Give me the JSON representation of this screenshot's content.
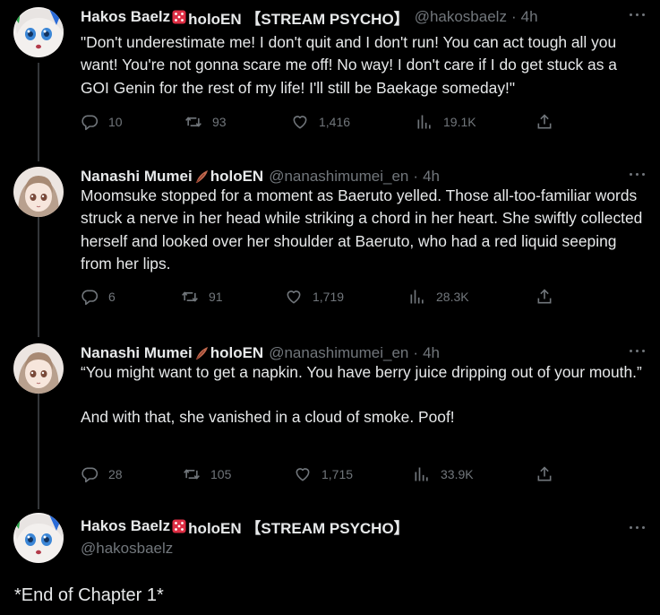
{
  "tweets": [
    {
      "name": "Hakos Baelz",
      "name_suffix": "holoEN 【STREAM PSYCHO】",
      "handle": "@hakosbaelz",
      "time": "4h",
      "text": [
        "\"Don't underestimate me! I don't quit and I don't run! You can act tough all you want! You're not gonna scare me off! No way! I don't care if I do get stuck as a GOI Genin for the rest of my life! I'll still be Baekage someday!\""
      ],
      "replies": "10",
      "retweets": "93",
      "likes": "1,416",
      "views": "19.1K"
    },
    {
      "name": "Nanashi Mumei",
      "name_suffix": "holoEN",
      "handle": "@nanashimumei_en",
      "time": "4h",
      "text": [
        "Moomsuke stopped for a moment as Baeruto yelled. Those all-too-familiar words struck a nerve in her head while striking a chord in her heart. She swiftly collected herself and looked over her shoulder at Baeruto, who had a red liquid seeping from her lips."
      ],
      "replies": "6",
      "retweets": "91",
      "likes": "1,719",
      "views": "28.3K"
    },
    {
      "name": "Nanashi Mumei",
      "name_suffix": "holoEN",
      "handle": "@nanashimumei_en",
      "time": "4h",
      "text": [
        "“You might want to get a napkin. You have berry juice dripping out of your mouth.”",
        "And with that, she vanished in a cloud of smoke. Poof!"
      ],
      "replies": "28",
      "retweets": "105",
      "likes": "1,715",
      "views": "33.9K"
    },
    {
      "name": "Hakos Baelz",
      "name_suffix": "holoEN 【STREAM PSYCHO】",
      "handle": "@hakosbaelz",
      "text": [
        "*End of Chapter 1*"
      ]
    }
  ],
  "icons": {
    "reply": "reply-icon",
    "retweet": "retweet-icon",
    "like": "heart-icon",
    "views": "views-icon",
    "share": "share-icon",
    "more": "more-icon",
    "die": "die-emoji",
    "quill": "quill-emoji"
  },
  "colors": {
    "background": "#000000",
    "text": "#e7e9ea",
    "muted": "#71767b",
    "line": "#333639"
  }
}
